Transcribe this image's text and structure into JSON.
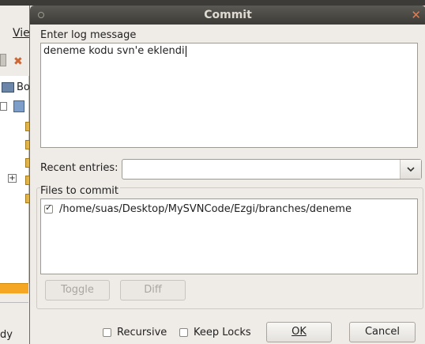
{
  "background_app": {
    "menu_view": "Vie",
    "tree_root_label": "Bo",
    "status_text": "dy"
  },
  "dialog": {
    "title": "Commit",
    "log_message": {
      "label": "Enter log message",
      "value": "deneme kodu svn'e eklendi"
    },
    "recent_entries": {
      "label": "Recent entries:",
      "value": ""
    },
    "files": {
      "label": "Files to commit",
      "items": [
        {
          "path": "/home/suas/Desktop/MySVNCode/Ezgi/branches/deneme",
          "checked": true
        }
      ]
    },
    "buttons": {
      "toggle": "Toggle",
      "diff": "Diff",
      "ok": "OK",
      "cancel": "Cancel"
    },
    "options": {
      "recursive": {
        "label": "Recursive",
        "checked": false
      },
      "keep_locks": {
        "label": "Keep Locks",
        "checked": false
      }
    },
    "colors": {
      "titlebar": "#3c3b37",
      "close_icon": "#f07746",
      "background": "#efebe7"
    }
  }
}
